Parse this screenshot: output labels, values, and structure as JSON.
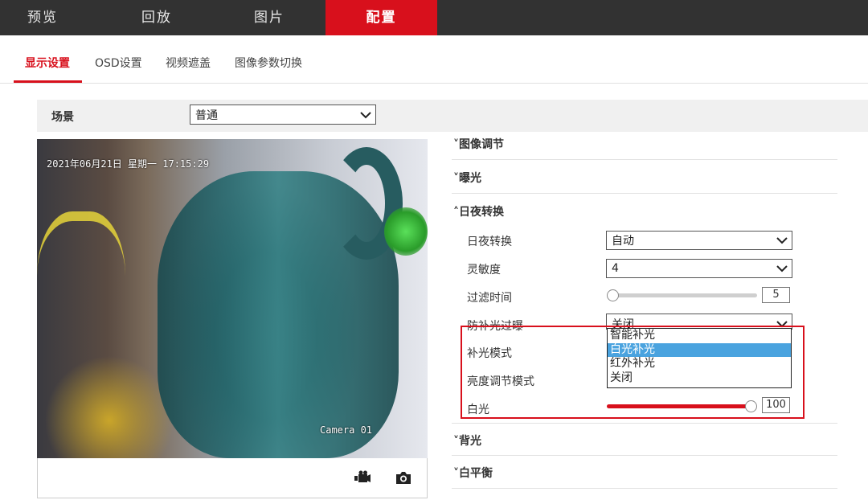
{
  "nav": {
    "items": [
      {
        "label": "预览"
      },
      {
        "label": "回放"
      },
      {
        "label": "图片"
      },
      {
        "label": "配置"
      }
    ]
  },
  "subtabs": [
    {
      "label": "显示设置"
    },
    {
      "label": "OSD设置"
    },
    {
      "label": "视频遮盖"
    },
    {
      "label": "图像参数切换"
    }
  ],
  "scene": {
    "label": "场景",
    "value": "普通"
  },
  "video": {
    "osd_time": "2021年06月21日 星期一 17:15:29",
    "osd_camera": "Camera 01"
  },
  "toolbar": {
    "record_icon": "video-record-icon",
    "snapshot_icon": "camera-snapshot-icon"
  },
  "sections": {
    "image_adjust": "图像调节",
    "exposure": "曝光",
    "day_night": "日夜转换",
    "backlight": "背光",
    "white_balance": "白平衡"
  },
  "day_night": {
    "switch_label": "日夜转换",
    "switch_value": "自动",
    "sensitivity_label": "灵敏度",
    "sensitivity_value": "4",
    "filter_time_label": "过滤时间",
    "filter_time_value": "5",
    "anti_overexposure_label": "防补光过曝",
    "anti_overexposure_value": "关闭",
    "fill_light_mode_label": "补光模式",
    "brightness_mode_label": "亮度调节模式",
    "white_light_label": "白光",
    "white_light_value": "100"
  },
  "fill_light_options": [
    {
      "label": "智能补光",
      "selected": false
    },
    {
      "label": "白光补光",
      "selected": true
    },
    {
      "label": "红外补光",
      "selected": false
    },
    {
      "label": "关闭",
      "selected": false
    }
  ],
  "colors": {
    "accent": "#d8101c",
    "selection": "#4aa3df",
    "nav_bg": "#323232"
  }
}
